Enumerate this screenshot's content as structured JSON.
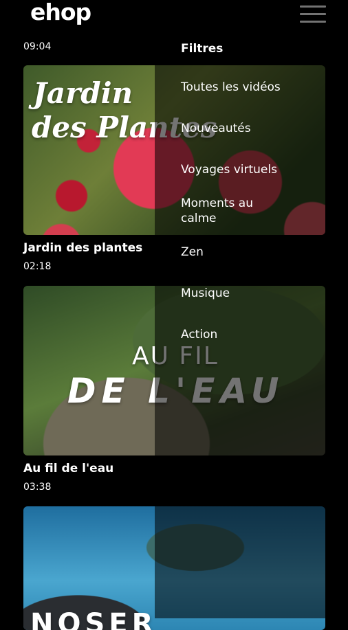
{
  "header": {
    "logo_text": "ehop"
  },
  "top_item": {
    "duration": "09:04"
  },
  "videos": [
    {
      "title": "Jardin des plantes",
      "duration": "02:18",
      "art_line1": "Jardin",
      "art_line2": "des Plantes"
    },
    {
      "title": "Au fil de l'eau",
      "duration": "03:38",
      "art_line1": "AU FIL",
      "art_line2": "DE L'EAU"
    },
    {
      "title": "",
      "duration": "",
      "art_line1": "NOSER"
    }
  ],
  "filters": {
    "heading": "Filtres",
    "items": [
      {
        "label": "Toutes les vidéos"
      },
      {
        "label": "Nouveautés"
      },
      {
        "label": "Voyages virtuels"
      },
      {
        "label": "Moments au calme"
      },
      {
        "label": "Zen"
      },
      {
        "label": "Musique"
      },
      {
        "label": "Action"
      }
    ]
  },
  "icons": {
    "menu": "hamburger-icon"
  }
}
